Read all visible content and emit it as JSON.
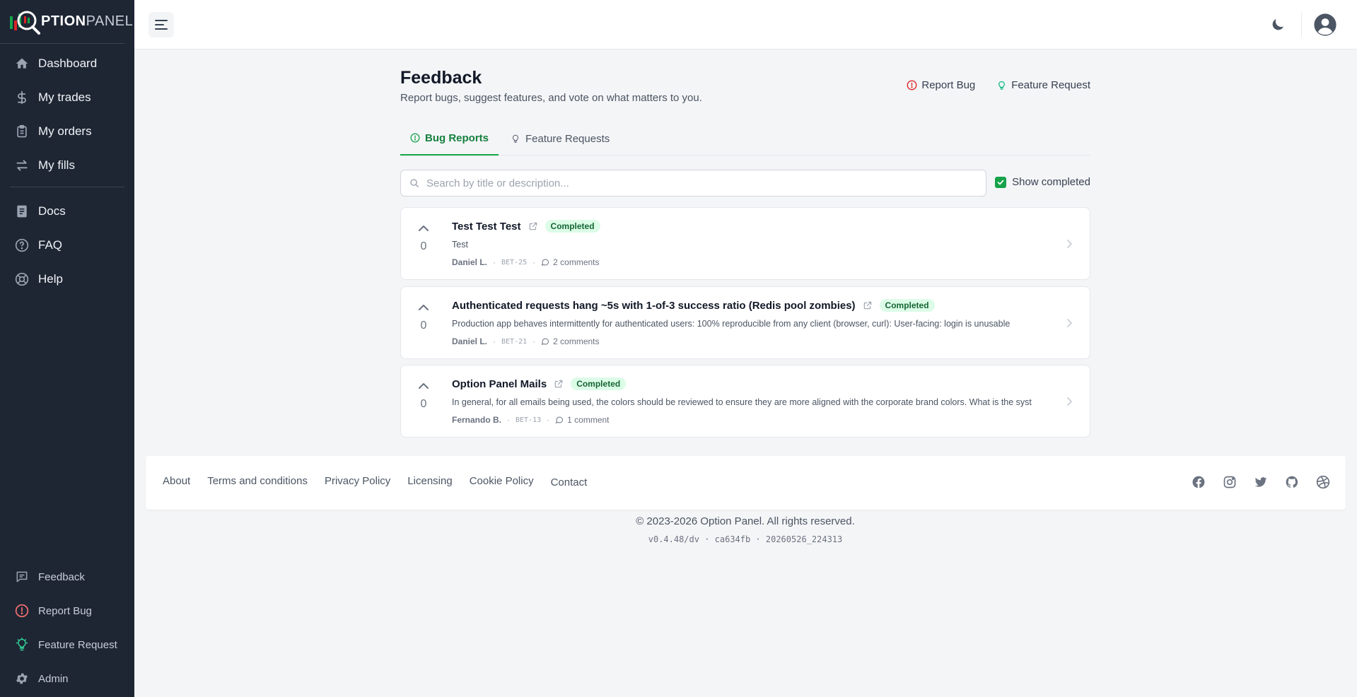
{
  "brand": {
    "logo_primary": "PTION",
    "logo_secondary": "PANEL",
    "logo_letter": "O",
    "accent": "#16a34a"
  },
  "sidebar": {
    "items": [
      {
        "label": "Dashboard",
        "icon": "home-icon"
      },
      {
        "label": "My trades",
        "icon": "dollar-icon"
      },
      {
        "label": "My orders",
        "icon": "clipboard-icon"
      },
      {
        "label": "My fills",
        "icon": "arrows-exchange-icon"
      },
      {
        "label": "Docs",
        "icon": "docs-icon"
      },
      {
        "label": "FAQ",
        "icon": "question-circle-icon"
      },
      {
        "label": "Help",
        "icon": "lifebuoy-icon"
      }
    ],
    "bottom_items": [
      {
        "label": "Feedback",
        "icon": "chat-bubble-icon"
      },
      {
        "label": "Report Bug",
        "icon": "alert-circle-icon"
      },
      {
        "label": "Feature Request",
        "icon": "lightbulb-icon"
      },
      {
        "label": "Admin",
        "icon": "gear-icon"
      }
    ]
  },
  "header": {
    "title": "Feedback",
    "subtitle": "Report bugs, suggest features, and vote on what matters to you.",
    "report_bug": "Report Bug",
    "feature_request": "Feature Request"
  },
  "tabs": [
    {
      "label": "Bug Reports",
      "active": true
    },
    {
      "label": "Feature Requests",
      "active": false
    }
  ],
  "search": {
    "placeholder": "Search by title or description...",
    "value": ""
  },
  "filter": {
    "show_completed_label": "Show completed",
    "show_completed": true
  },
  "items": [
    {
      "votes": "0",
      "title": "Test Test Test",
      "status": "Completed",
      "description": "Test",
      "author": "Daniel L.",
      "key": "BET-25",
      "comments": "2 comments"
    },
    {
      "votes": "0",
      "title": "Authenticated requests hang ~5s with 1-of-3 success ratio (Redis pool zombies)",
      "status": "Completed",
      "description": "Production app behaves intermittently for authenticated users: 100% reproducible from any client (browser, curl): User-facing: login is unusable",
      "author": "Daniel L.",
      "key": "BET-21",
      "comments": "2 comments"
    },
    {
      "votes": "0",
      "title": "Option Panel Mails",
      "status": "Completed",
      "description": "In general, for all emails being used, the colors should be reviewed to ensure they are more aligned with the corporate brand colors. What is the syst",
      "author": "Fernando B.",
      "key": "BET-13",
      "comments": "1 comment"
    }
  ],
  "footer": {
    "links": [
      "About",
      "Terms and conditions",
      "Privacy Policy",
      "Licensing",
      "Cookie Policy",
      "Contact"
    ],
    "social": [
      "facebook-icon",
      "instagram-icon",
      "twitter-icon",
      "github-icon",
      "dribbble-icon"
    ],
    "copyright": "© 2023-2026 Option Panel. All rights reserved.",
    "version": "v0.4.48/dv · ca634fb · 20260526_224313"
  }
}
